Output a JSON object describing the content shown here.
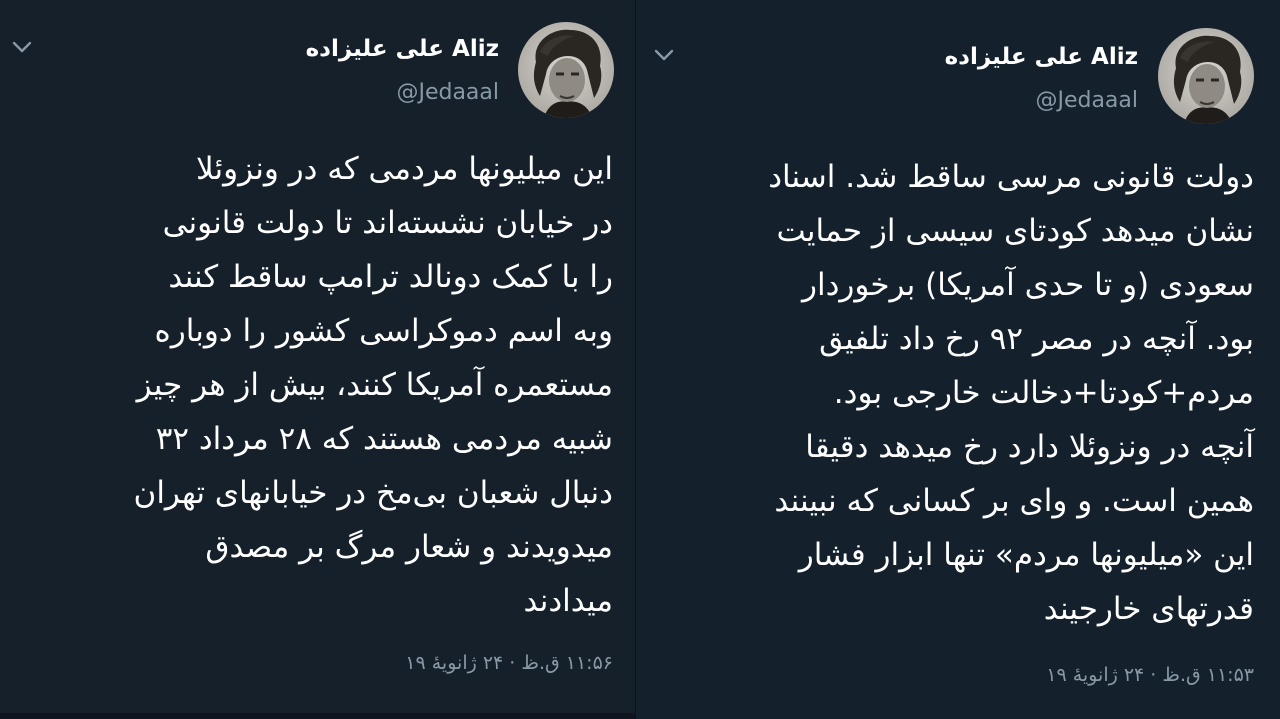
{
  "tweets": [
    {
      "display_name": "علی علیزاده Aliz",
      "handle": "@Jedaaal",
      "lines": [
        "این میلیونها مردمی که در ونزوئلا",
        "در خیابان نشسته‌اند تا دولت قانونی",
        "را با کمک دونالد ترامپ ساقط کنند",
        "وبه اسم دموکراسی کشور را دوباره",
        "مستعمره آمریکا کنند، بیش از هر چیز",
        "شبیه مردمی هستند که ۲۸ مرداد ۳۲",
        "دنبال شعبان بی‌مخ در خیابانهای تهران",
        "میدویدند و شعار مرگ بر مصدق",
        "میدادند"
      ],
      "timestamp": "۱۱:۵۶ ق.ظ · ۲۴ ژانویهٔ ۱۹",
      "chevron_icon": "chevron-down-icon",
      "avatar_icon": "avatar-photo"
    },
    {
      "display_name": "علی علیزاده Aliz",
      "handle": "@Jedaaal",
      "lines": [
        "دولت قانونی مرسی ساقط شد. اسناد",
        "نشان میدهد کودتای سیسی از حمایت",
        "سعودی (و تا حدی آمریکا) برخوردار",
        "بود. آنچه در مصر ۹۲ رخ داد تلفیق",
        "مردم+کودتا+دخالت خارجی بود.",
        "آنچه در ونزوئلا دارد رخ میدهد دقیقا",
        "همین است. و وای بر کسانی که نبینند",
        "این «میلیونها مردم» تنها ابزار فشار",
        "قدرتهای خارجیند"
      ],
      "timestamp": "۱۱:۵۳ ق.ظ · ۲۴ ژانویهٔ ۱۹",
      "chevron_icon": "chevron-down-icon",
      "avatar_icon": "avatar-photo"
    }
  ],
  "colors": {
    "background": "#15202b",
    "text": "#ffffff",
    "secondary_text": "#8899a6"
  }
}
